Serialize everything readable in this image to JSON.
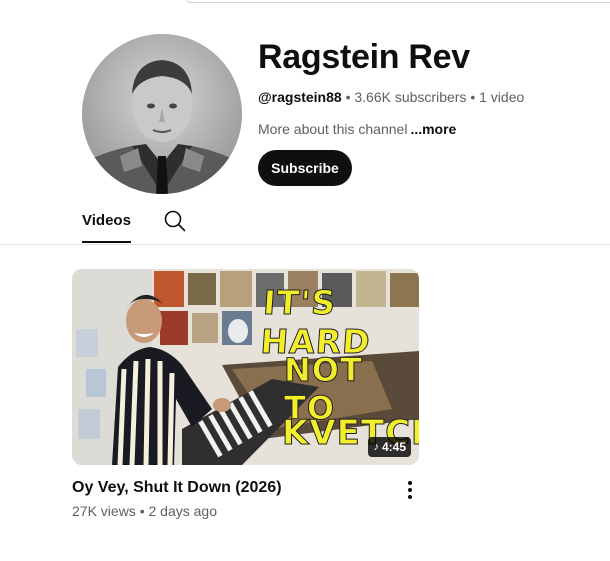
{
  "channel": {
    "name": "Ragstein Rev",
    "handle": "@ragstein88",
    "separator": " • ",
    "subscribers": "3.66K subscribers",
    "video_count": "1 video",
    "about": "More about this channel",
    "more": "...more",
    "subscribe_label": "Subscribe"
  },
  "tabs": [
    {
      "label": "Videos",
      "active": true
    }
  ],
  "icons": {
    "search": "search-icon",
    "more_actions": "more-vert-icon",
    "music_note": "music-note-icon"
  },
  "videos": [
    {
      "title": "Oy Vey, Shut It Down (2026)",
      "views": "27K views",
      "age": "2 days ago",
      "duration": "4:45",
      "thumbnail_text": [
        "IT'S HARD",
        "NOT TO",
        "KVETCH"
      ]
    }
  ],
  "colors": {
    "subscribe_bg": "#0f0f0f",
    "text_primary": "#0f0f0f",
    "text_secondary": "#606060",
    "thumbnail_text": "#f2ee2c"
  }
}
